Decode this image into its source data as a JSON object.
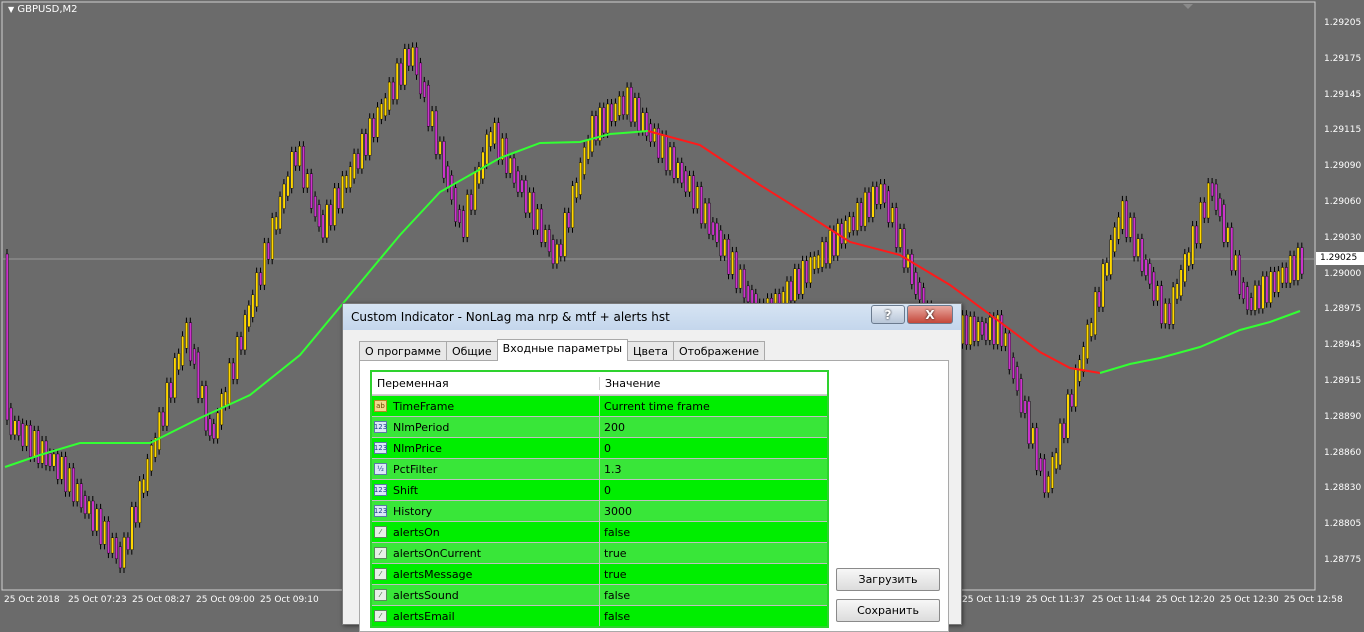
{
  "chart": {
    "symbol": "GBPUSD,M2",
    "current_price": "1.29025",
    "price_levels": [
      "1.29205",
      "1.29175",
      "1.29145",
      "1.29115",
      "1.29090",
      "1.29060",
      "1.29030",
      "1.29000",
      "1.28975",
      "1.28945",
      "1.28915",
      "1.28890",
      "1.28860",
      "1.28830",
      "1.28805",
      "1.28775"
    ],
    "time_labels": [
      "25 Oct 2018",
      "25 Oct 07:23",
      "25 Oct 08:27",
      "25 Oct 09:00",
      "25 Oct 09:10",
      "25 Oct 11:19",
      "25 Oct 11:37",
      "25 Oct 11:44",
      "25 Oct 12:20",
      "25 Oct 12:30",
      "25 Oct 12:58"
    ],
    "colors": {
      "background": "#6b6b6b",
      "bull": "#ffd700",
      "bear": "#cc33cc",
      "ma_up": "#33ff33",
      "ma_down": "#ff1a1a"
    }
  },
  "dialog": {
    "title": "Custom Indicator - NonLag ma nrp & mtf + alerts hst",
    "help_button": "?",
    "close_button": "X",
    "tabs": [
      {
        "label": "О программе"
      },
      {
        "label": "Общие"
      },
      {
        "label": "Входные параметры",
        "active": true
      },
      {
        "label": "Цвета"
      },
      {
        "label": "Отображение"
      }
    ],
    "columns": {
      "variable": "Переменная",
      "value": "Значение"
    },
    "params": [
      {
        "icon": "ab",
        "type": "string",
        "name": "TimeFrame",
        "value": "Current time frame"
      },
      {
        "icon": "123",
        "type": "int",
        "name": "NlmPeriod",
        "value": "200"
      },
      {
        "icon": "123",
        "type": "int",
        "name": "NlmPrice",
        "value": "0"
      },
      {
        "icon": "½",
        "type": "double",
        "name": "PctFilter",
        "value": "1.3"
      },
      {
        "icon": "123",
        "type": "int",
        "name": "Shift",
        "value": "0"
      },
      {
        "icon": "123",
        "type": "int",
        "name": "History",
        "value": "3000"
      },
      {
        "icon": "⁄",
        "type": "bool",
        "name": "alertsOn",
        "value": "false"
      },
      {
        "icon": "⁄",
        "type": "bool",
        "name": "alertsOnCurrent",
        "value": "true"
      },
      {
        "icon": "⁄",
        "type": "bool",
        "name": "alertsMessage",
        "value": "true"
      },
      {
        "icon": "⁄",
        "type": "bool",
        "name": "alertsSound",
        "value": "false"
      },
      {
        "icon": "⁄",
        "type": "bool",
        "name": "alertsEmail",
        "value": "false"
      }
    ],
    "load_button": "Загрузить",
    "save_button": "Сохранить"
  }
}
